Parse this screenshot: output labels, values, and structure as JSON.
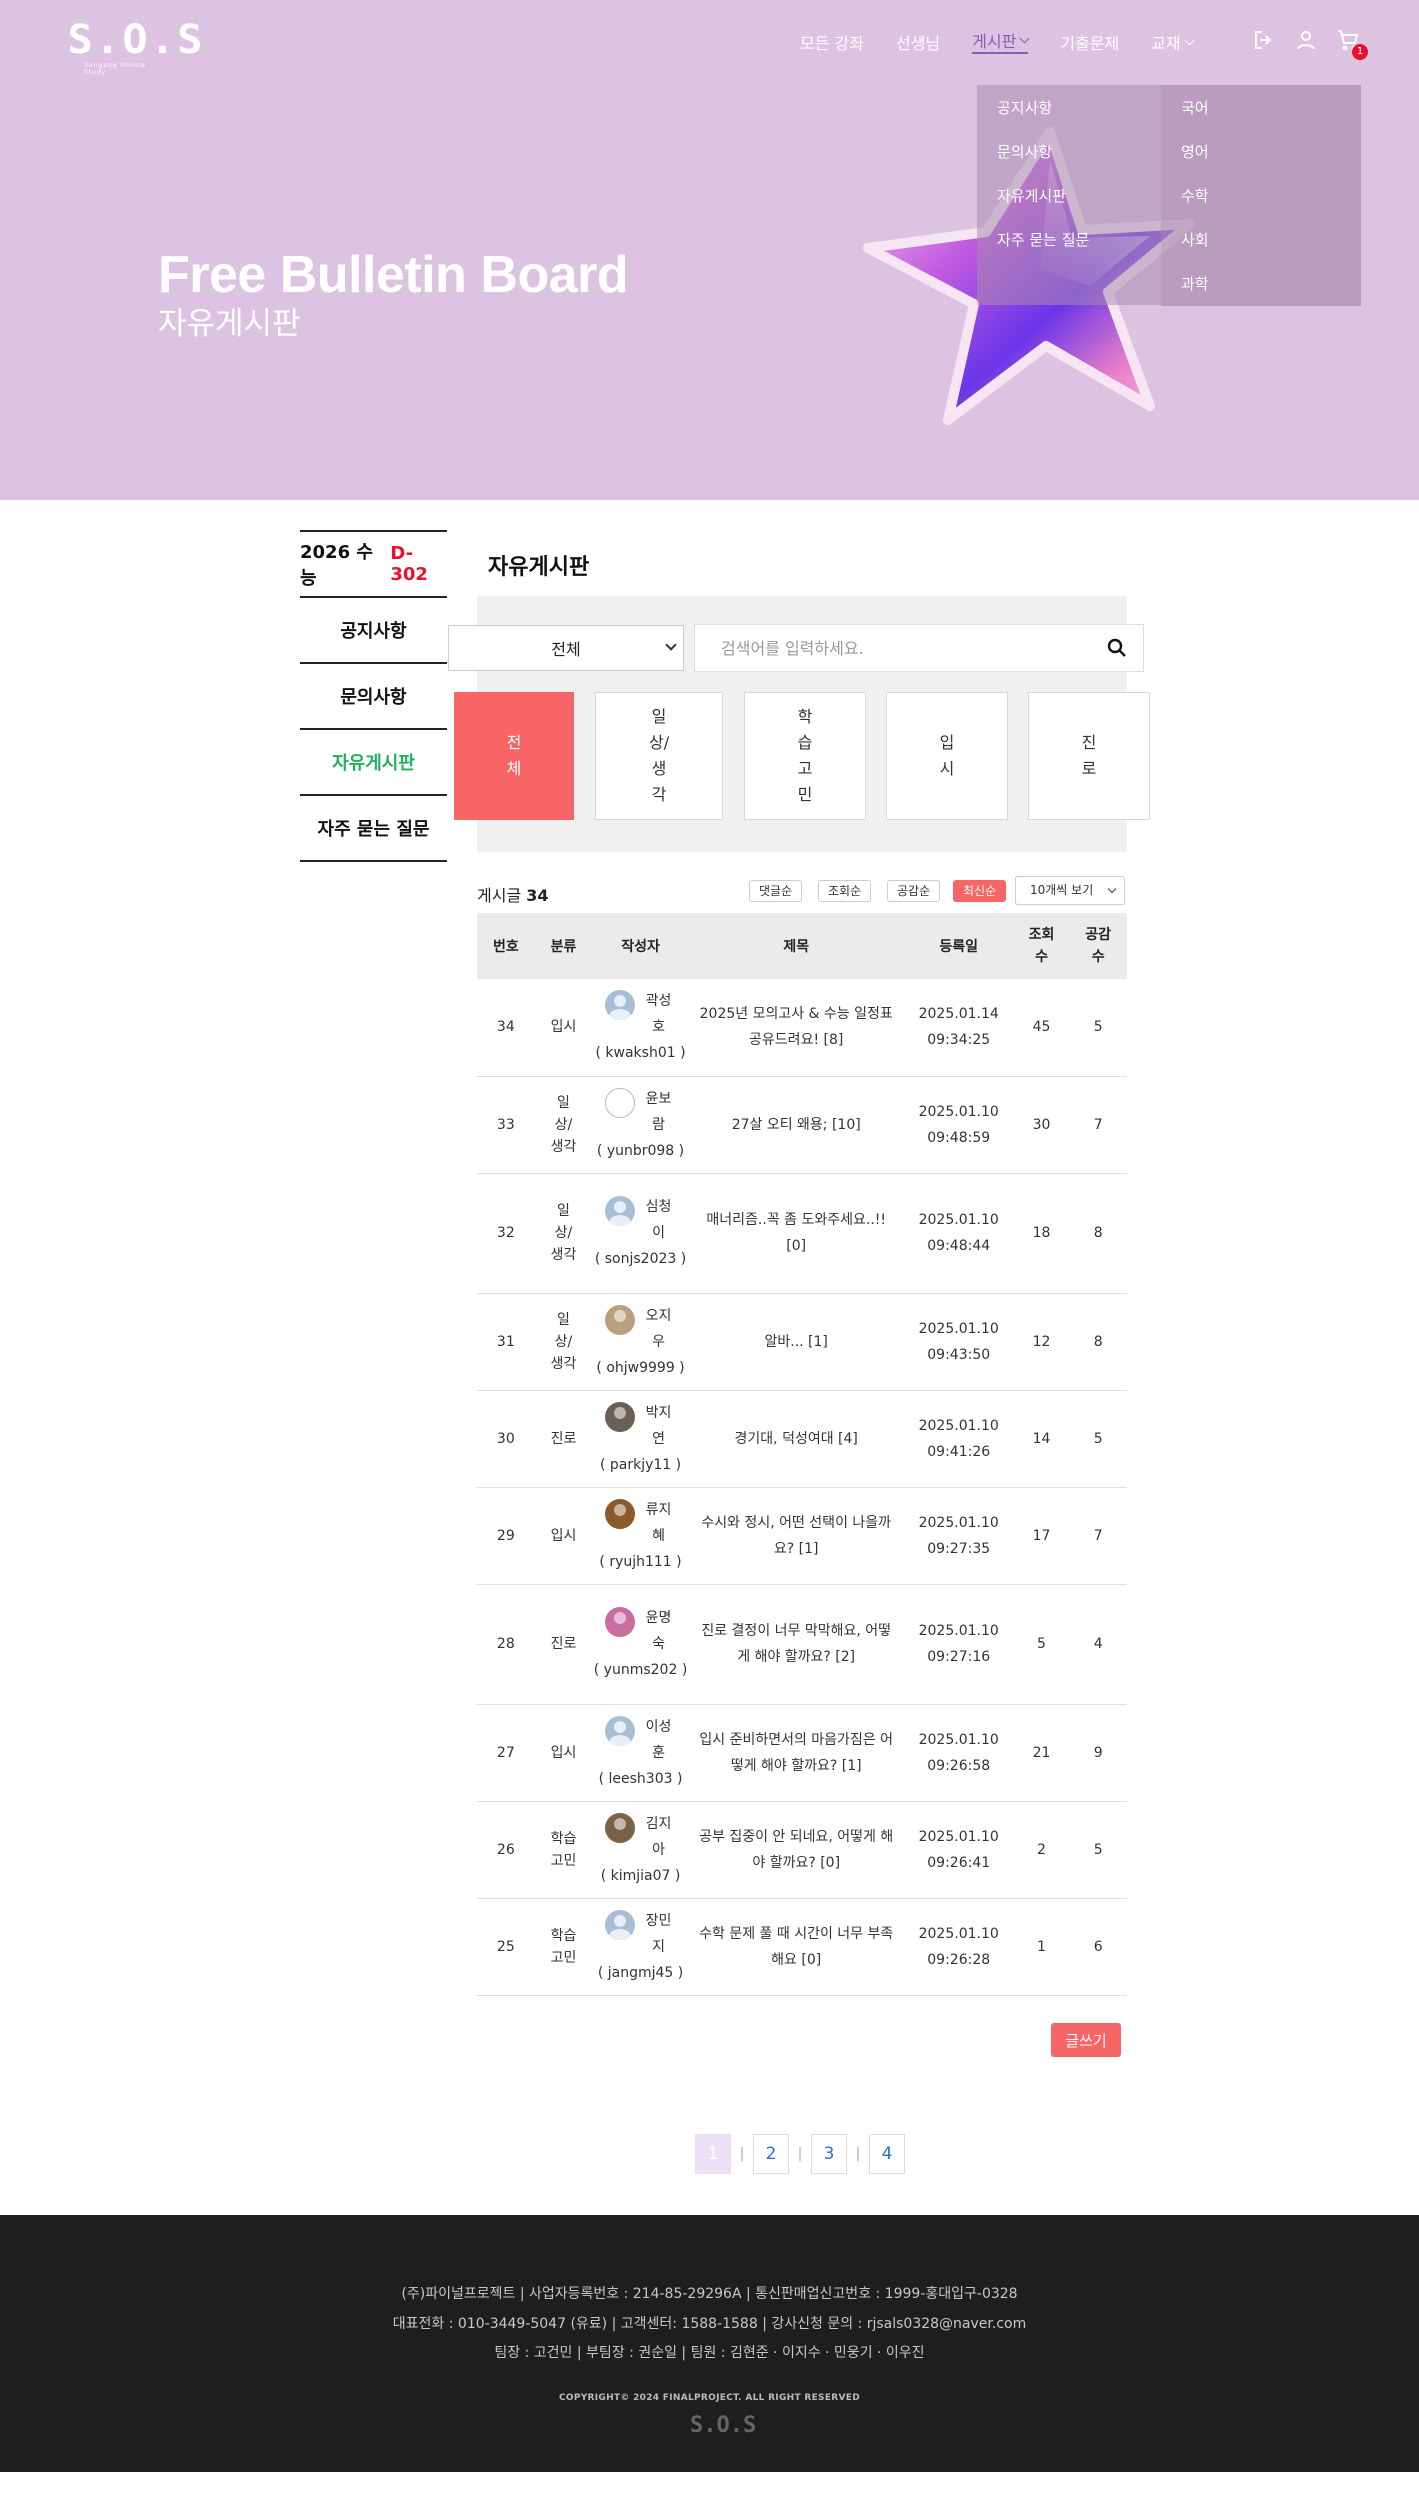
{
  "brand": {
    "logo": "S.O.S",
    "tagline": "Sungang Online Study"
  },
  "nav": {
    "items": [
      "모든 강좌",
      "선생님",
      "게시판",
      "기출문제",
      "교재"
    ],
    "cart_count": "1"
  },
  "dropdown": {
    "board_items": [
      "공지사항",
      "문의사항",
      "자유게시판",
      "자주 묻는 질문"
    ],
    "book_items": [
      "국어",
      "영어",
      "수학",
      "사회",
      "과학"
    ]
  },
  "hero": {
    "title": "Free Bulletin Board",
    "subtitle": "자유게시판"
  },
  "sidebar": {
    "dday_label": "2026 수능",
    "dday_value": "D-302",
    "items": [
      "공지사항",
      "문의사항",
      "자유게시판",
      "자주 묻는 질문"
    ]
  },
  "board": {
    "title": "자유게시판",
    "select_value": "전체",
    "search_placeholder": "검색어를 입력하세요.",
    "categories": [
      "전체",
      "일상/생각",
      "학습고민",
      "입시",
      "진로"
    ],
    "count_label": "게시글",
    "count_value": "34",
    "sort": [
      "댓글순",
      "조회순",
      "공감순",
      "최신순"
    ],
    "per_page": "10개씩 보기",
    "columns": [
      "번호",
      "분류",
      "작성자",
      "제목",
      "등록일",
      "조회수",
      "공감수"
    ],
    "rows": [
      {
        "no": "34",
        "cat": "입시",
        "name": "곽성호",
        "uid": "( kwaksh01 )",
        "title": "2025년 모의고사 & 수능 일정표 공유드려요! [8]",
        "date": "2025.01.14",
        "time": "09:34:25",
        "views": "45",
        "likes": "5"
      },
      {
        "no": "33",
        "cat": "일상/생각",
        "name": "윤보람",
        "uid": "( yunbr098 )",
        "title": "27살 오티 왜용; [10]",
        "date": "2025.01.10",
        "time": "09:48:59",
        "views": "30",
        "likes": "7"
      },
      {
        "no": "32",
        "cat": "일상/생각",
        "name": "심청이",
        "uid": "( sonjs2023 )",
        "title": "매너리즘..꼭 좀 도와주세요..!! [0]",
        "date": "2025.01.10",
        "time": "09:48:44",
        "views": "18",
        "likes": "8"
      },
      {
        "no": "31",
        "cat": "일상/생각",
        "name": "오지우",
        "uid": "( ohjw9999 )",
        "title": "알바... [1]",
        "date": "2025.01.10",
        "time": "09:43:50",
        "views": "12",
        "likes": "8"
      },
      {
        "no": "30",
        "cat": "진로",
        "name": "박지연",
        "uid": "( parkjy11 )",
        "title": "경기대, 덕성여대 [4]",
        "date": "2025.01.10",
        "time": "09:41:26",
        "views": "14",
        "likes": "5"
      },
      {
        "no": "29",
        "cat": "입시",
        "name": "류지혜",
        "uid": "( ryujh111 )",
        "title": "수시와 정시, 어떤 선택이 나을까요? [1]",
        "date": "2025.01.10",
        "time": "09:27:35",
        "views": "17",
        "likes": "7"
      },
      {
        "no": "28",
        "cat": "진로",
        "name": "윤명숙",
        "uid": "( yunms202 )",
        "title": "진로 결정이 너무 막막해요, 어떻게 해야 할까요? [2]",
        "date": "2025.01.10",
        "time": "09:27:16",
        "views": "5",
        "likes": "4"
      },
      {
        "no": "27",
        "cat": "입시",
        "name": "이성훈",
        "uid": "( leesh303 )",
        "title": "입시 준비하면서의 마음가짐은 어떻게 해야 할까요? [1]",
        "date": "2025.01.10",
        "time": "09:26:58",
        "views": "21",
        "likes": "9"
      },
      {
        "no": "26",
        "cat": "학습고민",
        "name": "김지아",
        "uid": "( kimjia07 )",
        "title": "공부 집중이 안 되네요, 어떻게 해야 할까요? [0]",
        "date": "2025.01.10",
        "time": "09:26:41",
        "views": "2",
        "likes": "5"
      },
      {
        "no": "25",
        "cat": "학습고민",
        "name": "장민지",
        "uid": "( jangmj45 )",
        "title": "수학 문제 풀 때 시간이 너무 부족해요 [0]",
        "date": "2025.01.10",
        "time": "09:26:28",
        "views": "1",
        "likes": "6"
      }
    ],
    "write_label": "글쓰기"
  },
  "pagination": [
    "1",
    "2",
    "3",
    "4"
  ],
  "footer": {
    "line1": "(주)파이널프로젝트 | 사업자등록번호 : 214-85-29296A | 통신판매업신고번호 : 1999-홍대입구-0328",
    "line2": "대표전화 : 010-3449-5047 (유료) | 고객센터: 1588-1588 | 강사신청 문의 : rjsals0328@naver.com",
    "line3": "팀장 : 고건민  |  부팀장 : 권순일  |  팀원 : 김현준 · 이지수 · 민웅기 · 이우진",
    "copyright": "COPYRIGHT© 2024 FINALPROJECT. ALL RIGHT RESERVED",
    "logo": "S.O.S"
  },
  "colors": {
    "hero_bg": "#dcc3e2",
    "accent": "#f76566",
    "sidebar_active": "#1db35a",
    "dday": "#e8102b",
    "footer_bg": "#1e1e1e"
  }
}
